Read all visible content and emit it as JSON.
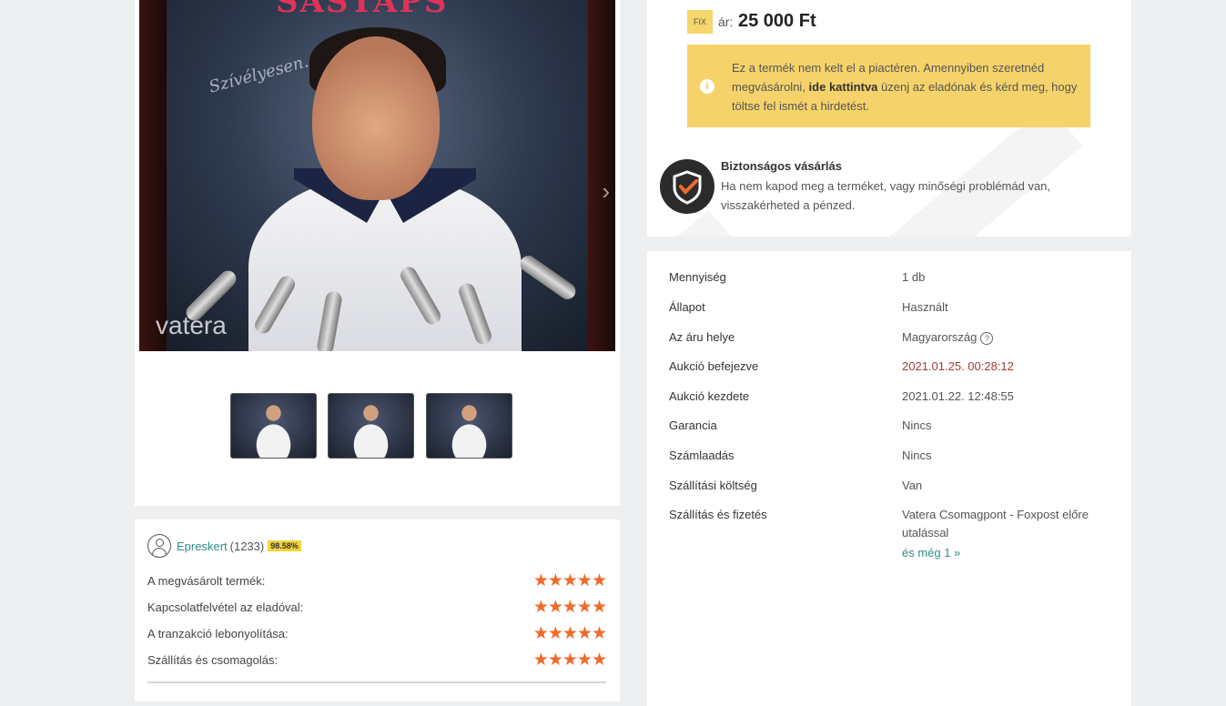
{
  "gallery": {
    "watermark": "vatera",
    "thumbnails": [
      {
        "alt": "thumbnail-1"
      },
      {
        "alt": "thumbnail-2"
      },
      {
        "alt": "thumbnail-3"
      }
    ]
  },
  "seller": {
    "name": "Epreskert",
    "count": "(1233)",
    "rating_badge": "98.58%",
    "ratings": [
      {
        "label": "A megvásárolt termék:",
        "stars": "★★★★★"
      },
      {
        "label": "Kapcsolatfelvétel az eladóval:",
        "stars": "★★★★★"
      },
      {
        "label": "A tranzakció lebonyolítása:",
        "stars": "★★★★★"
      },
      {
        "label": "Szállítás és csomagolás:",
        "stars": "★★★★★"
      }
    ]
  },
  "price": {
    "fix_badge": "FIX",
    "label": "ár:",
    "value": "25 000 Ft"
  },
  "notice": {
    "text_before": "Ez a termék nem kelt el a piactéren. Amennyiben szeretnéd megvásárolni, ",
    "link": "ide kattintva",
    "text_after": " üzenj az eladónak és kérd meg, hogy töltse fel ismét a hirdetést."
  },
  "secure": {
    "title": "Biztonságos vásárlás",
    "text": "Ha nem kapod meg a terméket, vagy minőségi problémád van, visszakérheted a pénzed."
  },
  "details": {
    "rows": [
      {
        "label": "Mennyiség",
        "value": "1 db"
      },
      {
        "label": "Állapot",
        "value": "Használt"
      },
      {
        "label": "Az áru helye",
        "value": "Magyarország"
      },
      {
        "label": "Aukció befejezve",
        "value": "2021.01.25. 00:28:12"
      },
      {
        "label": "Aukció kezdete",
        "value": "2021.01.22. 12:48:55"
      },
      {
        "label": "Garancia",
        "value": "Nincs"
      },
      {
        "label": "Számlaadás",
        "value": "Nincs"
      },
      {
        "label": "Szállítási költség",
        "value": "Van"
      },
      {
        "label": "Szállítás és fizetés",
        "value": "Vatera Csomagpont - Foxpost előre utalással"
      }
    ],
    "more_link": "és még 1 »",
    "help_icon": "?"
  },
  "colors": {
    "accent": "#2f8c86",
    "notice_bg": "#f6d36a",
    "star": "#f06a2a",
    "ended_date": "#a33a3a"
  }
}
